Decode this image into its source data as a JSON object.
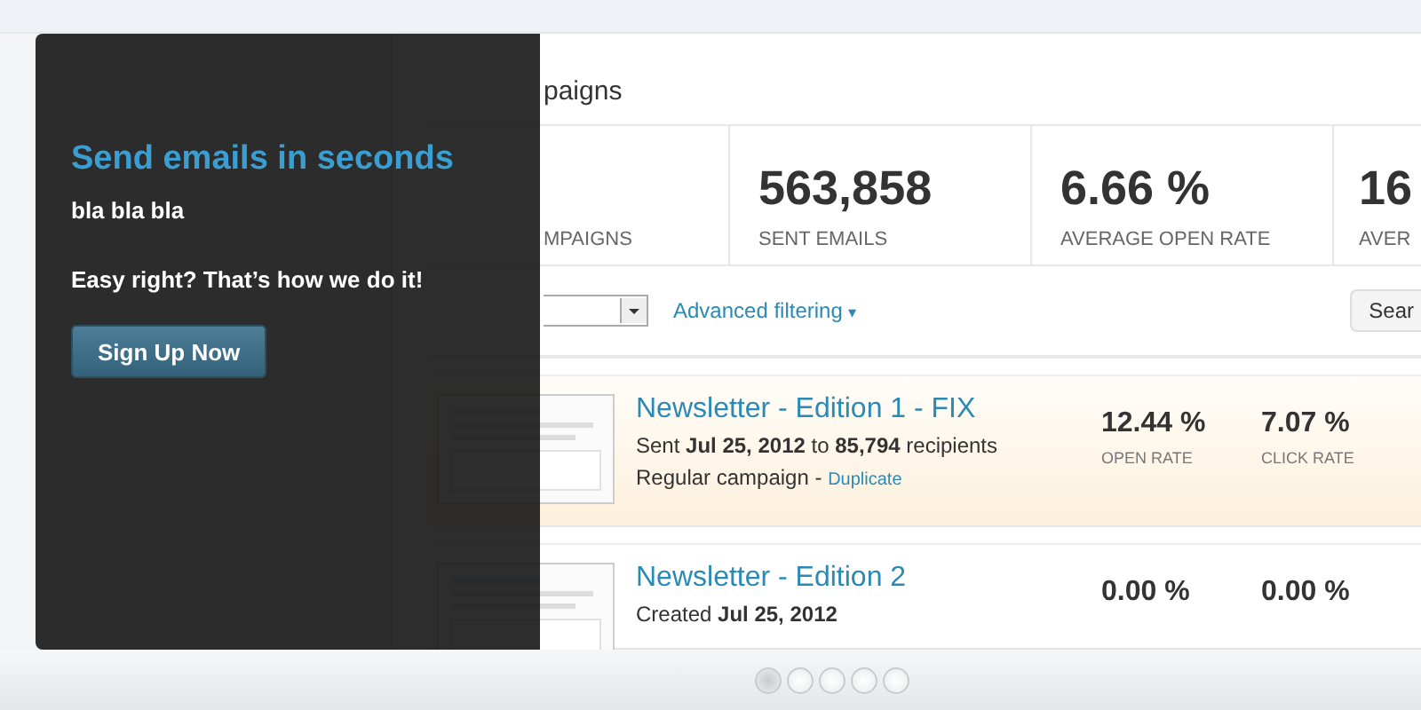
{
  "slide": {
    "title": "paigns",
    "stats": [
      {
        "label": "MPAIGNS"
      },
      {
        "value": "563,858",
        "label": "SENT EMAILS"
      },
      {
        "value": "6.66 %",
        "label": "AVERAGE OPEN RATE"
      },
      {
        "value": "16",
        "label": "AVER"
      }
    ],
    "filter": {
      "advanced_link": "Advanced filtering",
      "advanced_caret": "▾",
      "search_button": "Sear"
    },
    "campaigns": [
      {
        "kind": "delivered",
        "title": "Newsletter - Edition 1 - FIX",
        "details": "Sent **Jul 25, 2012** to **85,794** recipients",
        "type": "Regular campaign -",
        "action": "Duplicate",
        "open_rate": "12.44 %",
        "open_label": "OPEN RATE",
        "click_rate": "7.07 %",
        "click_label": "CLICK RATE"
      },
      {
        "kind": "draft",
        "title": "Newsletter - Edition 2",
        "details": "Created **Jul 25, 2012**",
        "open_rate": "0.00 %",
        "click_rate": "0.00 %"
      }
    ]
  },
  "caption": {
    "title": "Send emails in seconds",
    "lines": [
      "bla bla bla",
      "Easy right? That’s how we do it!"
    ],
    "button": "Sign Up Now"
  },
  "pager": [
    {
      "selected": true
    },
    {
      "selected": false
    },
    {
      "selected": false
    },
    {
      "selected": false
    },
    {
      "selected": false
    }
  ]
}
